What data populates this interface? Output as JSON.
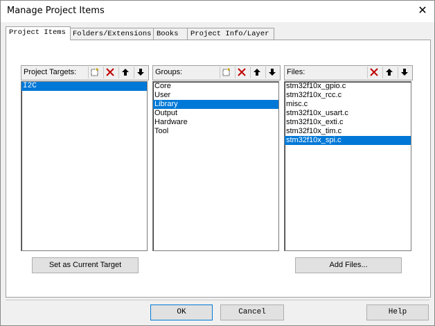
{
  "window": {
    "title": "Manage Project Items",
    "close_label": "✕"
  },
  "tabs": [
    {
      "label": "Project Items"
    },
    {
      "label": "Folders/Extensions"
    },
    {
      "label": "Books"
    },
    {
      "label": "Project Info/Layer"
    }
  ],
  "targets": {
    "label": "Project Targets:",
    "items": [
      "I2C"
    ]
  },
  "groups": {
    "label": "Groups:",
    "items": [
      "Core",
      "User",
      "Library",
      "Output",
      "Hardware",
      "Tool"
    ]
  },
  "files": {
    "label": "Files:",
    "items": [
      "stm32f10x_gpio.c",
      "stm32f10x_rcc.c",
      "misc.c",
      "stm32f10x_usart.c",
      "stm32f10x_exti.c",
      "stm32f10x_tim.c",
      "stm32f10x_spi.c"
    ]
  },
  "buttons": {
    "set_current_target": "Set as Current Target",
    "add_files": "Add Files...",
    "ok": "OK",
    "cancel": "Cancel",
    "help": "Help"
  },
  "colors": {
    "selection": "#0078d7",
    "delete_icon": "#c00000"
  }
}
